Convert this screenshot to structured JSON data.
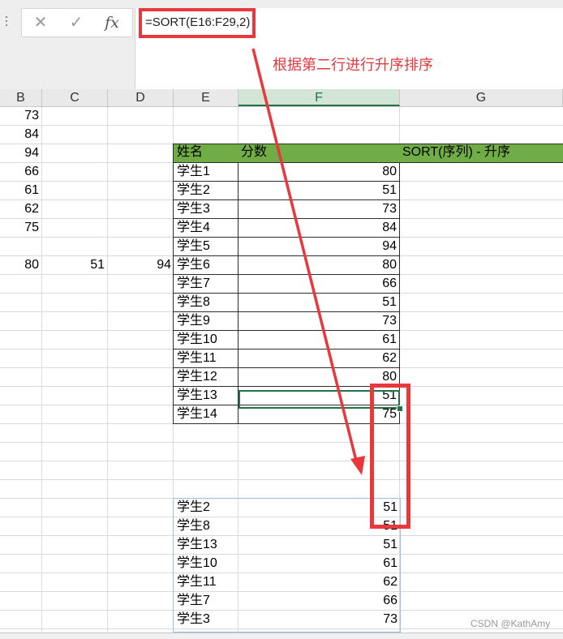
{
  "formula_bar": {
    "cancel_icon": "✕",
    "enter_icon": "✓",
    "fx_label": "fx",
    "formula": "=SORT(E16:F29,2)"
  },
  "annotation": "根据第二行进行升序排序",
  "columns": [
    "B",
    "C",
    "D",
    "E",
    "F",
    "G"
  ],
  "active_column": "F",
  "column_b_values": [
    "73",
    "84",
    "94",
    "66",
    "61",
    "62",
    "75"
  ],
  "row_8_values": [
    "80",
    "51",
    "94"
  ],
  "source_table": {
    "headers": [
      "姓名",
      "分数",
      "SORT(序列)  -  升序"
    ],
    "rows": [
      [
        "学生1",
        "80"
      ],
      [
        "学生2",
        "51"
      ],
      [
        "学生3",
        "73"
      ],
      [
        "学生4",
        "84"
      ],
      [
        "学生5",
        "94"
      ],
      [
        "学生6",
        "80"
      ],
      [
        "学生7",
        "66"
      ],
      [
        "学生8",
        "51"
      ],
      [
        "学生9",
        "73"
      ],
      [
        "学生10",
        "61"
      ],
      [
        "学生11",
        "62"
      ],
      [
        "学生12",
        "80"
      ],
      [
        "学生13",
        "51"
      ],
      [
        "学生14",
        "75"
      ]
    ]
  },
  "sorted_result": {
    "rows": [
      [
        "学生2",
        "51"
      ],
      [
        "学生8",
        "51"
      ],
      [
        "学生13",
        "51"
      ],
      [
        "学生10",
        "61"
      ],
      [
        "学生11",
        "62"
      ],
      [
        "学生7",
        "66"
      ],
      [
        "学生3",
        "73"
      ]
    ]
  },
  "colors": {
    "header_fill": "#70ad47",
    "highlight_red": "#e8383d",
    "excel_green": "#217346"
  },
  "watermark": "CSDN @KathAmy"
}
